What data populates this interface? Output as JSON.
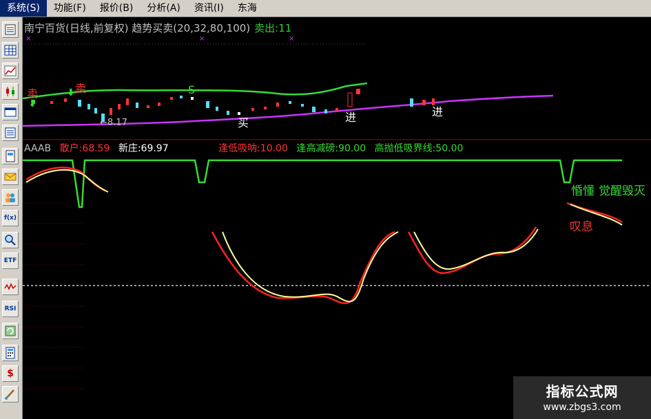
{
  "menu": {
    "items": [
      "系统(S)",
      "功能(F)",
      "报价(B)",
      "分析(A)",
      "资讯(I)",
      "东海"
    ]
  },
  "toolbar": {
    "buttons": [
      {
        "icon": "quote-list-icon"
      },
      {
        "icon": "grid-table-icon"
      },
      {
        "icon": "line-chart-icon"
      },
      {
        "icon": "candlestick-icon"
      },
      {
        "icon": "window-icon"
      },
      {
        "icon": "list-icon"
      },
      {
        "icon": "document-icon"
      },
      {
        "icon": "mail-icon"
      },
      {
        "icon": "users-icon"
      },
      {
        "icon": "function-icon",
        "text": "f(x)"
      },
      {
        "icon": "magnify-icon"
      },
      {
        "icon": "etf-icon",
        "text": "ETF"
      },
      {
        "icon": "wave-icon"
      },
      {
        "icon": "rsi-icon",
        "text": "RSI"
      },
      {
        "icon": "refresh-icon"
      },
      {
        "icon": "calculator-icon"
      },
      {
        "icon": "dollar-icon",
        "text": "$"
      },
      {
        "icon": "brush-icon"
      }
    ]
  },
  "main_chart": {
    "title": "南宁百货(日线,前复权) 趋势买卖(20,32,80,100)",
    "sell_label": "卖出:11",
    "low_price": "←8.17",
    "markers": {
      "sell1": "卖",
      "sell2": "卖",
      "s": "S",
      "buy": "买",
      "in1": "进",
      "in2": "进"
    }
  },
  "indicator": {
    "name": "AAAB",
    "retail": "散户:68.59",
    "new_dealer": "新庄:69.97",
    "low_absorb": "逢低吸呐:10.00",
    "high_reduce": "逢高减磅:90.00",
    "boundary": "高抛低吸界线:50.00",
    "label_awake": "觉醒",
    "label_dawn": "惛懂",
    "label_destroy": "毁灭",
    "label_sigh": "叹息"
  },
  "watermark": {
    "title": "指标公式网",
    "url": "www.zbgs3.com"
  },
  "colors": {
    "green": "#33dd33",
    "red": "#ff2222",
    "magenta": "#cc33ff",
    "yellow": "#ffff99",
    "cyan": "#55ddff",
    "menu_bg": "#d4d0c8"
  }
}
